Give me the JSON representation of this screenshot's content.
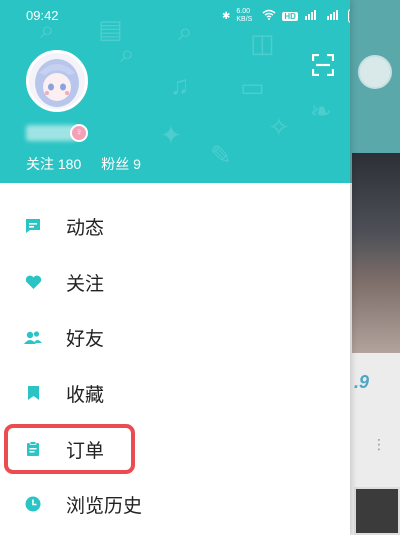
{
  "status_bar": {
    "time": "09:42",
    "speed": "6.00 KB/S",
    "battery": "82",
    "signal_label": "HD"
  },
  "profile": {
    "followers_label": "关注 180",
    "fans_label": "粉丝 9"
  },
  "menu": {
    "items": [
      {
        "label": "动态",
        "icon": "message-square-icon"
      },
      {
        "label": "关注",
        "icon": "heart-icon"
      },
      {
        "label": "好友",
        "icon": "users-icon"
      },
      {
        "label": "收藏",
        "icon": "bookmark-icon"
      },
      {
        "label": "订单",
        "icon": "order-list-icon"
      },
      {
        "label": "浏览历史",
        "icon": "clock-icon"
      }
    ]
  },
  "background_app": {
    "partial_number": ".9"
  },
  "colors": {
    "accent": "#2bc4c4",
    "highlight": "#ea4c50",
    "text": "#222222"
  }
}
